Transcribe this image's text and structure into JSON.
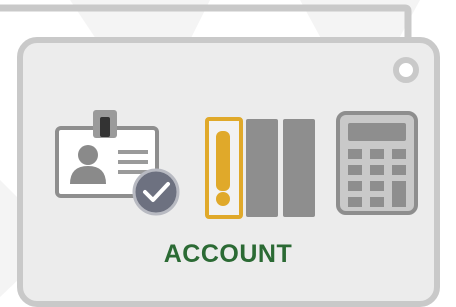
{
  "card": {
    "title": "ACCOUNT"
  },
  "icons": [
    "id-badge-icon",
    "binders-icon",
    "calculator-icon"
  ],
  "colors": {
    "title": "#2b6a34",
    "binder_accent": "#e0a92a",
    "card_bg": "#ececec",
    "card_border": "#c9c9c9"
  }
}
